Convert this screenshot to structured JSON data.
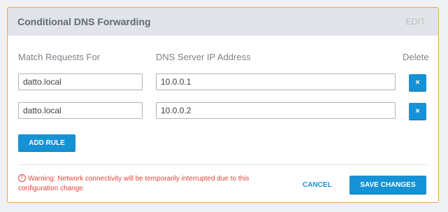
{
  "card": {
    "title": "Conditional DNS Forwarding",
    "edit_label": "EDIT"
  },
  "columns": {
    "match": "Match Requests For",
    "dns": "DNS Server IP Address",
    "delete": "Delete"
  },
  "rules": [
    {
      "match": "datto.local",
      "dns": "10.0.0.1",
      "delete_glyph": "×"
    },
    {
      "match": "datto.local",
      "dns": "10.0.0.2",
      "delete_glyph": "×"
    }
  ],
  "add_rule_label": "ADD RULE",
  "warning": {
    "icon": "!",
    "text": "Warning: Network connectivity will be temporarily interrupted due to this configuration change."
  },
  "actions": {
    "cancel_label": "CANCEL",
    "save_label": "SAVE CHANGES"
  },
  "colors": {
    "accent": "#1592d6",
    "card_border": "#f0a64a",
    "warning": "#e2463a",
    "header_bg": "#e1e4e8"
  },
  "icons": {
    "delete": "close-icon",
    "warning": "warning-circle-icon"
  }
}
